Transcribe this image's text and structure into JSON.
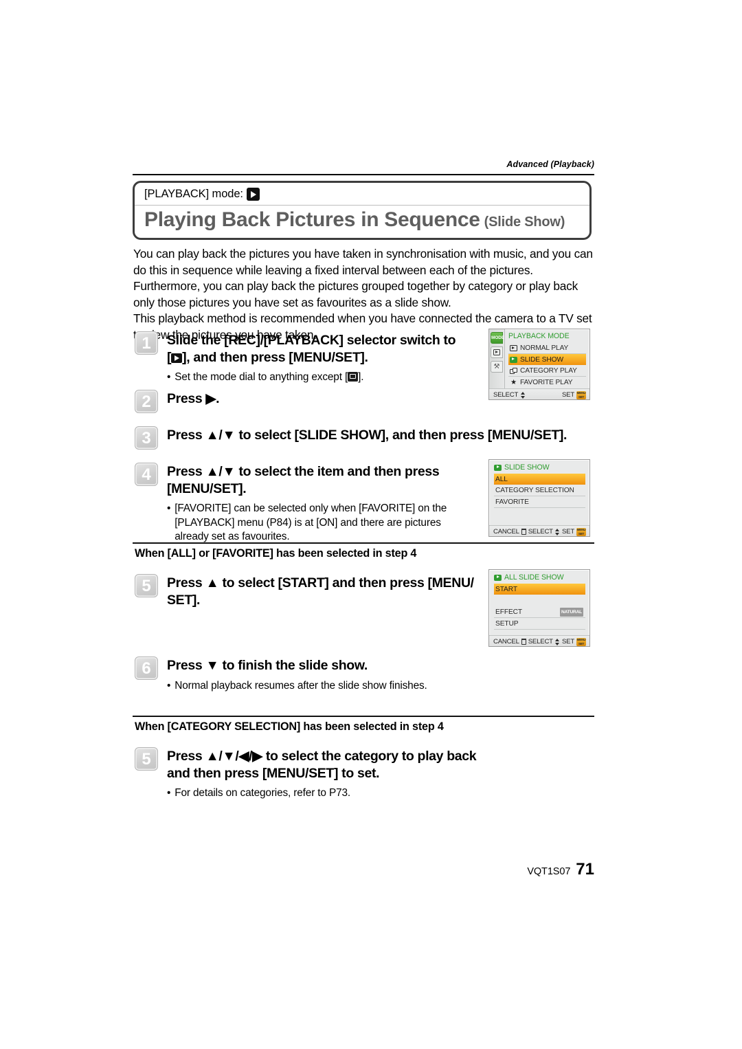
{
  "runhead": "Advanced (Playback)",
  "header": {
    "mode_label": "[PLAYBACK] mode:",
    "mode_icon": "playback-play-icon",
    "title_main": "Playing Back Pictures in Sequence",
    "title_sub": "(Slide Show)"
  },
  "intro": [
    "You can play back the pictures you have taken in synchronisation with music, and you can",
    "do this in sequence while leaving a fixed interval between each of the pictures.",
    "Furthermore, you can play back the pictures grouped together by category or play back",
    "only those pictures you have set as favourites as a slide show.",
    "This playback method is recommended when you have connected the camera to a TV set",
    "to view the pictures you have taken."
  ],
  "steps": {
    "s1": {
      "num": "1",
      "line1": "Slide the [REC]/[PLAYBACK] selector switch to",
      "line2_pre": "[",
      "line2_post": "], and then press [MENU/SET].",
      "bullet_pre": "Set the mode dial to anything except [",
      "bullet_post": "].",
      "bullet_dot": "•"
    },
    "s2": {
      "num": "2",
      "title": "Press ▶."
    },
    "s3": {
      "num": "3",
      "title": "Press ▲/▼ to select [SLIDE SHOW], and then press [MENU/SET]."
    },
    "s4": {
      "num": "4",
      "line1": "Press ▲/▼ to select the item and then press",
      "line2": "[MENU/SET].",
      "bullet_dot": "•",
      "bullet": "[FAVORITE] can be selected only when [FAVORITE] on the [PLAYBACK] menu (P84) is at [ON] and there are pictures already set as favourites."
    },
    "s5a": {
      "num": "5",
      "line1": "Press ▲ to select [START] and then press [MENU/",
      "line2": "SET]."
    },
    "s6": {
      "num": "6",
      "title": "Press ▼ to finish the slide show.",
      "bullet_dot": "•",
      "bullet": "Normal playback resumes after the slide show finishes."
    },
    "s5b": {
      "num": "5",
      "line1": "Press ▲/▼/◀/▶ to select the category to play back",
      "line2": "and then press [MENU/SET] to set.",
      "bullet_dot": "•",
      "bullet": "For details on categories, refer to P73."
    }
  },
  "subheads": {
    "all_favorite": "When [ALL] or [FAVORITE] has been selected in step 4",
    "category": "When [CATEGORY SELECTION] has been selected in step 4"
  },
  "lcd_playback_mode": {
    "title": "PLAYBACK MODE",
    "tabs": [
      {
        "name": "mode-tab",
        "label": "MODE"
      },
      {
        "name": "playback-tab",
        "label": ""
      },
      {
        "name": "setup-tab",
        "label": "⚒"
      }
    ],
    "items": [
      {
        "icon": "normal-play-icon",
        "label": "NORMAL PLAY",
        "selected": false
      },
      {
        "icon": "slide-show-icon",
        "label": "SLIDE SHOW",
        "selected": true
      },
      {
        "icon": "category-play-icon",
        "label": "CATEGORY PLAY",
        "selected": false
      },
      {
        "icon": "favorite-play-icon",
        "label": "FAVORITE PLAY",
        "selected": false
      }
    ],
    "footer": {
      "select": "SELECT",
      "set": "SET",
      "set_icon_label": "MENU SET"
    }
  },
  "lcd_slide_show": {
    "title": "SLIDE SHOW",
    "title_icon": "slide-show-icon",
    "items": [
      {
        "label": "ALL",
        "selected": true
      },
      {
        "label": "CATEGORY SELECTION",
        "selected": false
      },
      {
        "label": "FAVORITE",
        "selected": false
      }
    ],
    "footer": {
      "cancel": "CANCEL",
      "select": "SELECT",
      "set": "SET",
      "set_icon_label": "MENU SET"
    }
  },
  "lcd_all_slide_show": {
    "title": "ALL SLIDE SHOW",
    "title_icon": "slide-show-icon",
    "items": [
      {
        "label": "START",
        "value": "",
        "selected": true
      },
      {
        "label": "EFFECT",
        "value": "NATURAL",
        "selected": false
      },
      {
        "label": "SETUP",
        "value": "",
        "selected": false
      }
    ],
    "footer": {
      "cancel": "CANCEL",
      "select": "SELECT",
      "set": "SET",
      "set_icon_label": "MENU SET"
    }
  },
  "footer": {
    "code": "VQT1S07",
    "page": "71"
  },
  "colors": {
    "accent_green": "#2f9c2f",
    "highlight_orange": "#f0920f",
    "title_gray": "#5e5e5e"
  }
}
